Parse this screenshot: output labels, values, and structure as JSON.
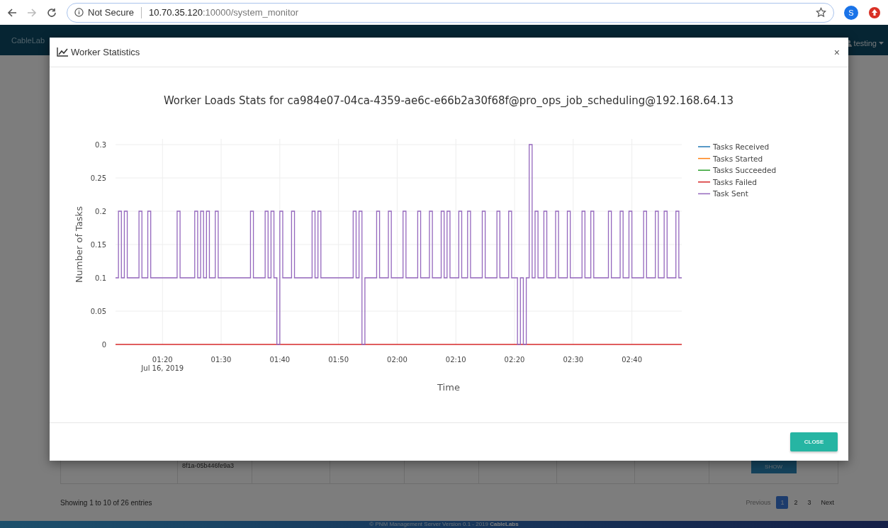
{
  "browser": {
    "security_label": "Not Secure",
    "url_host": "10.70.35.120",
    "url_path": ":10000/system_monitor",
    "profile_initial": "S"
  },
  "navbar": {
    "brand": "CableLab",
    "user": "testing"
  },
  "background_table": {
    "cell_text": "8f1a-05b446fe9a3",
    "button": "SHOW"
  },
  "table_info": "Showing 1 to 10 of 26 entries",
  "pagination": {
    "previous": {
      "label": "Previous",
      "disabled": true
    },
    "pages": [
      {
        "label": "1",
        "selected": true
      },
      {
        "label": "2",
        "selected": false
      },
      {
        "label": "3",
        "selected": false
      }
    ],
    "next": {
      "label": "Next",
      "disabled": false
    }
  },
  "footer": "© PNM Management Server Version 0.1 - 2019 **CableLabs**",
  "modal": {
    "title": "Worker Statistics",
    "close_symbol": "×",
    "buttons": [
      "CLOSE"
    ],
    "chart_data": {
      "type": "line",
      "title": "Worker Loads Stats for ca984e07-04ca-4359-ae6c-e66b2a30f68f@pro_ops_job_scheduling@192.168.64.13",
      "xlabel": "Time",
      "ylabel": "Number of Tasks",
      "xlim": [
        72,
        168.5
      ],
      "ylim": [
        0,
        0.3
      ],
      "xticks": [
        {
          "value": 80,
          "label": "01:20"
        },
        {
          "value": 90,
          "label": "01:30"
        },
        {
          "value": 100,
          "label": "01:40"
        },
        {
          "value": 110,
          "label": "01:50"
        },
        {
          "value": 120,
          "label": "02:00"
        },
        {
          "value": 130,
          "label": "02:10"
        },
        {
          "value": 140,
          "label": "02:20"
        },
        {
          "value": 150,
          "label": "02:30"
        },
        {
          "value": 160,
          "label": "02:40"
        }
      ],
      "yticks": [
        0,
        0.05,
        0.1,
        0.15,
        0.2,
        0.25,
        0.3
      ],
      "annotations": [
        "Jul 16, 2019"
      ],
      "grid": true,
      "legend": true,
      "series": [
        {
          "name": "Tasks Received",
          "color": "#1f77b4"
        },
        {
          "name": "Tasks Started",
          "color": "#ff7f0e"
        },
        {
          "name": "Tasks Succeeded",
          "color": "#2ca02c"
        },
        {
          "name": "Tasks Failed",
          "color": "#d62728",
          "x": [
            72,
            168.5
          ],
          "values": [
            0,
            0
          ]
        },
        {
          "name": "Task Sent",
          "color": "#9467bd",
          "x": [
            72,
            72.5,
            73,
            73.5,
            74,
            76,
            76.5,
            77.5,
            78,
            82.5,
            83,
            85.5,
            86,
            86.5,
            87,
            87.5,
            88,
            89,
            89.5,
            95,
            95.5,
            97.5,
            98,
            98.5,
            99,
            99.5,
            100,
            100.5,
            102,
            102.5,
            105.5,
            106,
            106.5,
            107,
            112.5,
            113,
            113.5,
            114,
            114.5,
            116.5,
            117,
            118.5,
            119,
            121,
            121.5,
            123.5,
            124,
            125.5,
            126,
            127.5,
            128,
            128.5,
            129,
            130.5,
            131,
            132,
            132.5,
            134.5,
            135,
            137,
            137.5,
            139,
            139.5,
            140.5,
            141,
            141.5,
            142,
            142.5,
            143,
            143.5,
            144,
            145,
            145.5,
            147,
            147.5,
            149,
            149.5,
            151.5,
            152,
            153,
            153.5,
            156,
            156.5,
            158,
            158.5,
            159.5,
            160,
            162,
            162.5,
            164,
            164.5,
            165.5,
            166,
            167.5,
            168,
            168.5
          ],
          "values": [
            0.1,
            0.2,
            0.1,
            0.2,
            0.1,
            0.2,
            0.1,
            0.2,
            0.1,
            0.2,
            0.1,
            0.2,
            0.1,
            0.2,
            0.1,
            0.2,
            0.1,
            0.2,
            0.1,
            0.2,
            0.1,
            0.2,
            0.1,
            0.2,
            0.1,
            0,
            0.2,
            0.1,
            0.2,
            0.1,
            0.2,
            0.1,
            0.2,
            0.1,
            0.2,
            0.1,
            0.2,
            0,
            0.1,
            0.2,
            0.1,
            0.2,
            0.1,
            0.2,
            0.1,
            0.2,
            0.1,
            0.2,
            0.1,
            0.2,
            0.1,
            0.2,
            0.1,
            0.2,
            0.1,
            0.2,
            0.1,
            0.2,
            0.1,
            0.2,
            0.1,
            0.2,
            0.1,
            0,
            0.1,
            0,
            0.1,
            0.3,
            0.1,
            0.2,
            0.1,
            0.2,
            0.1,
            0.2,
            0.1,
            0.2,
            0.1,
            0.2,
            0.1,
            0.2,
            0.1,
            0.2,
            0.1,
            0.2,
            0.1,
            0.2,
            0.1,
            0.2,
            0.1,
            0.2,
            0.1,
            0.2,
            0.1,
            0.2,
            0.1,
            0.1
          ]
        }
      ]
    }
  }
}
